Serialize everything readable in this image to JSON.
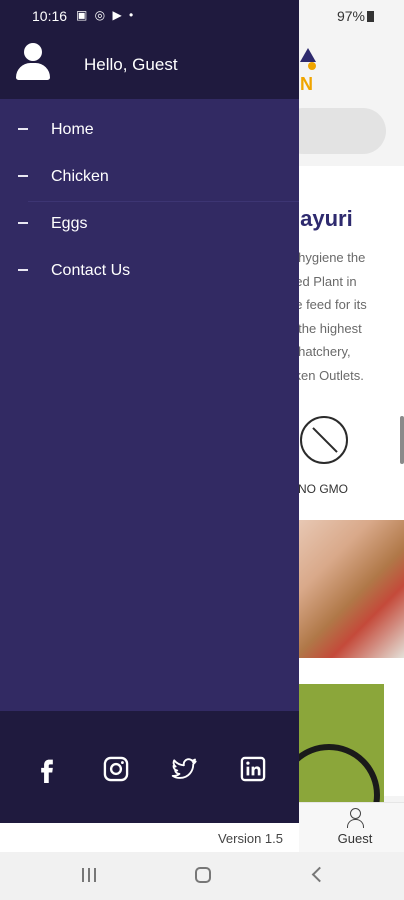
{
  "status_bar": {
    "time": "10:16",
    "notification_icons": "▣ ◎ ▶ •",
    "battery": "97%"
  },
  "drawer": {
    "greeting": "Hello, Guest",
    "menu": [
      {
        "label": "Home",
        "icon": "dash-icon"
      },
      {
        "label": "Chicken",
        "icon": "dash-icon"
      },
      {
        "label": "Eggs",
        "icon": "dash-icon"
      },
      {
        "label": "Contact Us",
        "icon": "dash-icon"
      }
    ],
    "social": [
      "facebook-icon",
      "instagram-icon",
      "twitter-icon",
      "linkedin-icon"
    ],
    "version": "Version 1.5"
  },
  "background": {
    "heading": "layuri",
    "paragraph_lines": [
      "s hygiene the",
      "eed Plant in",
      "ne feed for its",
      "s the highest",
      "s hatchery,",
      "cken Outlets."
    ],
    "gmo_label": "NO GMO",
    "guest_tab": "Guest"
  },
  "colors": {
    "drawer": "#322a63",
    "drawer_header": "#1f1a3e",
    "accent": "#f0a500"
  }
}
